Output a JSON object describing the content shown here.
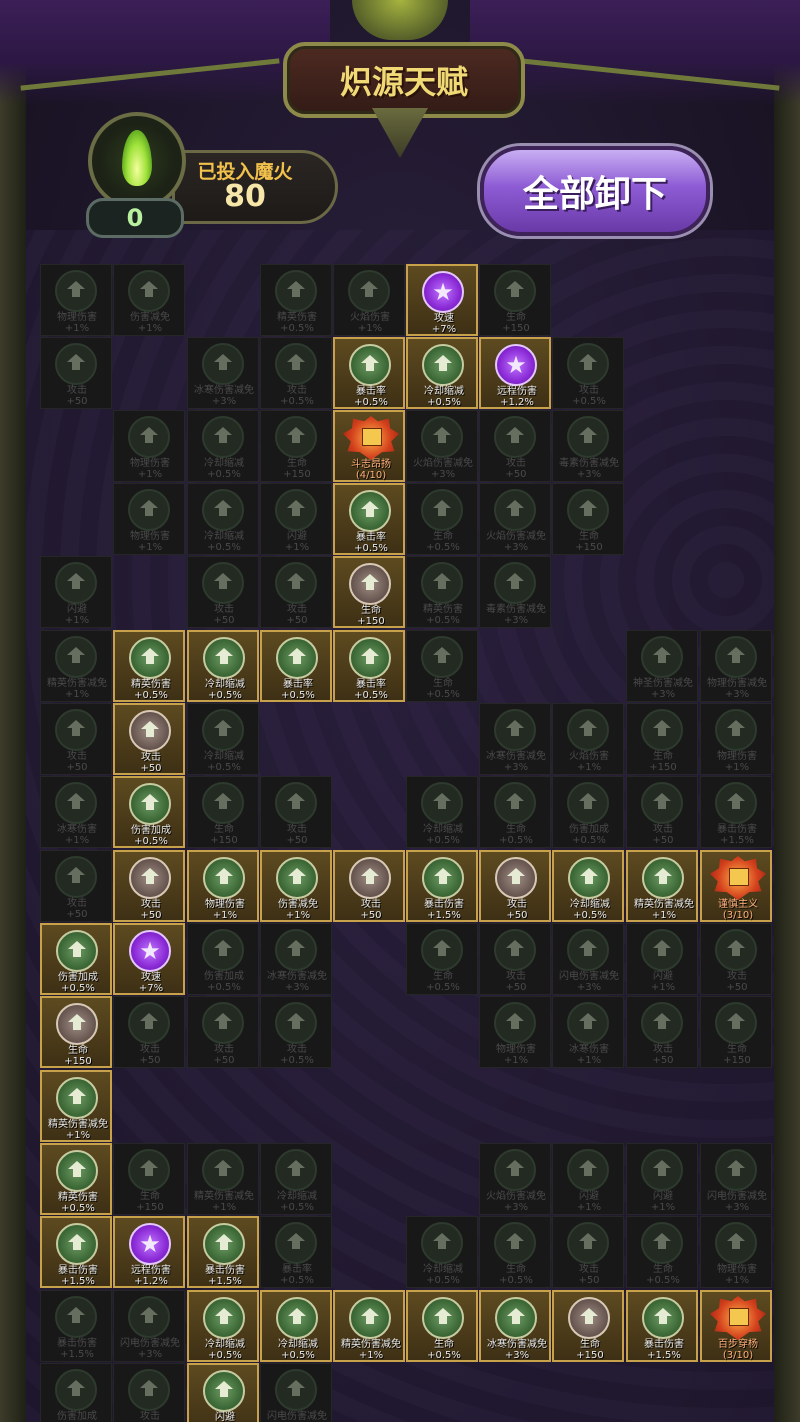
{
  "header": {
    "title": "炽源天赋"
  },
  "fire": {
    "invested_label": "已投入魔火",
    "invested_value": "80",
    "available": "0"
  },
  "actions": {
    "unload_all_label": "全部卸下"
  },
  "colors": {
    "active_border": "#c8a24a",
    "green_node": "#3e6b38",
    "brown_node": "#6c5b54",
    "purple_node": "#8a2ad6",
    "rank_node": "#d4411d",
    "button": "#8d5bd4"
  },
  "talents": [
    {
      "id": "t0",
      "name": "物理伤害",
      "bonus": "+1%",
      "state": "inactive",
      "icon": "arrow-up-icon"
    },
    {
      "id": "t1",
      "name": "伤害减免",
      "bonus": "+1%",
      "state": "inactive",
      "icon": "arrow-up-icon"
    },
    {
      "id": "t2",
      "name": "精英伤害",
      "bonus": "+0.5%",
      "state": "inactive",
      "icon": "arrow-up-icon"
    },
    {
      "id": "t3",
      "name": "火焰伤害",
      "bonus": "+1%",
      "state": "inactive",
      "icon": "arrow-up-icon"
    },
    {
      "id": "t4",
      "name": "攻速",
      "bonus": "+7%",
      "state": "active",
      "color": "purple",
      "icon": "star-icon"
    },
    {
      "id": "t5",
      "name": "生命",
      "bonus": "+150",
      "state": "inactive",
      "icon": "arrow-up-icon"
    },
    {
      "id": "t6",
      "name": "攻击",
      "bonus": "+50",
      "state": "inactive",
      "icon": "arrow-up-icon"
    },
    {
      "id": "t7",
      "name": "冰寒伤害减免",
      "bonus": "+3%",
      "state": "inactive",
      "icon": "arrow-up-icon"
    },
    {
      "id": "t8",
      "name": "攻击",
      "bonus": "+0.5%",
      "state": "inactive",
      "icon": "arrow-up-icon"
    },
    {
      "id": "t9",
      "name": "暴击率",
      "bonus": "+0.5%",
      "state": "active",
      "color": "green",
      "icon": "arrow-up-icon"
    },
    {
      "id": "t10",
      "name": "冷却缩减",
      "bonus": "+0.5%",
      "state": "active",
      "color": "green",
      "icon": "arrow-up-icon"
    },
    {
      "id": "t11",
      "name": "远程伤害",
      "bonus": "+1.2%",
      "state": "active",
      "color": "purple",
      "icon": "star-icon"
    },
    {
      "id": "t12",
      "name": "攻击",
      "bonus": "+0.5%",
      "state": "inactive",
      "icon": "arrow-up-icon"
    },
    {
      "id": "t13",
      "name": "物理伤害",
      "bonus": "+1%",
      "state": "inactive",
      "icon": "arrow-up-icon"
    },
    {
      "id": "t14",
      "name": "冷却缩减",
      "bonus": "+0.5%",
      "state": "inactive",
      "icon": "arrow-up-icon"
    },
    {
      "id": "t15",
      "name": "生命",
      "bonus": "+150",
      "state": "inactive",
      "icon": "arrow-up-icon"
    },
    {
      "id": "t16",
      "name": "斗志昂扬",
      "bonus": "(4/10)",
      "state": "rank",
      "icon": "shield-icon"
    },
    {
      "id": "t17",
      "name": "火焰伤害减免",
      "bonus": "+3%",
      "state": "inactive",
      "icon": "arrow-up-icon"
    },
    {
      "id": "t18",
      "name": "攻击",
      "bonus": "+50",
      "state": "inactive",
      "icon": "arrow-up-icon"
    },
    {
      "id": "t19",
      "name": "毒素伤害减免",
      "bonus": "+3%",
      "state": "inactive",
      "icon": "arrow-up-icon"
    },
    {
      "id": "t20",
      "name": "物理伤害",
      "bonus": "+1%",
      "state": "inactive",
      "icon": "arrow-up-icon"
    },
    {
      "id": "t21",
      "name": "冷却缩减",
      "bonus": "+0.5%",
      "state": "inactive",
      "icon": "arrow-up-icon"
    },
    {
      "id": "t22",
      "name": "闪避",
      "bonus": "+1%",
      "state": "inactive",
      "icon": "arrow-up-icon"
    },
    {
      "id": "t23",
      "name": "暴击率",
      "bonus": "+0.5%",
      "state": "active",
      "color": "green",
      "icon": "arrow-up-icon"
    },
    {
      "id": "t24",
      "name": "生命",
      "bonus": "+0.5%",
      "state": "inactive",
      "icon": "arrow-up-icon"
    },
    {
      "id": "t25",
      "name": "火焰伤害减免",
      "bonus": "+3%",
      "state": "inactive",
      "icon": "arrow-up-icon"
    },
    {
      "id": "t26",
      "name": "生命",
      "bonus": "+150",
      "state": "inactive",
      "icon": "arrow-up-icon"
    },
    {
      "id": "t27",
      "name": "闪避",
      "bonus": "+1%",
      "state": "inactive",
      "icon": "arrow-up-icon"
    },
    {
      "id": "t28",
      "name": "攻击",
      "bonus": "+50",
      "state": "inactive",
      "icon": "arrow-up-icon"
    },
    {
      "id": "t29",
      "name": "攻击",
      "bonus": "+50",
      "state": "inactive",
      "icon": "arrow-up-icon"
    },
    {
      "id": "t30",
      "name": "生命",
      "bonus": "+150",
      "state": "active",
      "color": "brown",
      "icon": "arrow-up-icon"
    },
    {
      "id": "t31",
      "name": "精英伤害",
      "bonus": "+0.5%",
      "state": "inactive",
      "icon": "arrow-up-icon"
    },
    {
      "id": "t32",
      "name": "毒素伤害减免",
      "bonus": "+3%",
      "state": "inactive",
      "icon": "arrow-up-icon"
    },
    {
      "id": "t33",
      "name": "精英伤害减免",
      "bonus": "+1%",
      "state": "inactive",
      "icon": "arrow-up-icon"
    },
    {
      "id": "t34",
      "name": "精英伤害",
      "bonus": "+0.5%",
      "state": "active",
      "color": "green",
      "icon": "arrow-up-icon"
    },
    {
      "id": "t35",
      "name": "冷却缩减",
      "bonus": "+0.5%",
      "state": "active",
      "color": "green",
      "icon": "arrow-up-icon"
    },
    {
      "id": "t36",
      "name": "暴击率",
      "bonus": "+0.5%",
      "state": "active",
      "color": "green",
      "icon": "arrow-up-icon"
    },
    {
      "id": "t37",
      "name": "暴击率",
      "bonus": "+0.5%",
      "state": "active",
      "color": "green",
      "icon": "arrow-up-icon"
    },
    {
      "id": "t38",
      "name": "生命",
      "bonus": "+0.5%",
      "state": "inactive",
      "icon": "arrow-up-icon"
    },
    {
      "id": "t39",
      "name": "神圣伤害减免",
      "bonus": "+3%",
      "state": "inactive",
      "icon": "arrow-up-icon"
    },
    {
      "id": "t40",
      "name": "物理伤害减免",
      "bonus": "+3%",
      "state": "inactive",
      "icon": "arrow-up-icon"
    },
    {
      "id": "t41",
      "name": "攻击",
      "bonus": "+50",
      "state": "inactive",
      "icon": "arrow-up-icon"
    },
    {
      "id": "t42",
      "name": "攻击",
      "bonus": "+50",
      "state": "active",
      "color": "brown",
      "icon": "arrow-up-icon"
    },
    {
      "id": "t43",
      "name": "冷却缩减",
      "bonus": "+0.5%",
      "state": "inactive",
      "icon": "arrow-up-icon"
    },
    {
      "id": "t44",
      "name": "冰寒伤害减免",
      "bonus": "+3%",
      "state": "inactive",
      "icon": "arrow-up-icon"
    },
    {
      "id": "t45",
      "name": "火焰伤害",
      "bonus": "+1%",
      "state": "inactive",
      "icon": "arrow-up-icon"
    },
    {
      "id": "t46",
      "name": "生命",
      "bonus": "+150",
      "state": "inactive",
      "icon": "arrow-up-icon"
    },
    {
      "id": "t47",
      "name": "物理伤害",
      "bonus": "+1%",
      "state": "inactive",
      "icon": "arrow-up-icon"
    },
    {
      "id": "t48",
      "name": "冰寒伤害",
      "bonus": "+1%",
      "state": "inactive",
      "icon": "arrow-up-icon"
    },
    {
      "id": "t49",
      "name": "伤害加成",
      "bonus": "+0.5%",
      "state": "active",
      "color": "green",
      "icon": "arrow-up-icon"
    },
    {
      "id": "t50",
      "name": "生命",
      "bonus": "+150",
      "state": "inactive",
      "icon": "arrow-up-icon"
    },
    {
      "id": "t51",
      "name": "攻击",
      "bonus": "+50",
      "state": "inactive",
      "icon": "arrow-up-icon"
    },
    {
      "id": "t52",
      "name": "冷却缩减",
      "bonus": "+0.5%",
      "state": "inactive",
      "icon": "arrow-up-icon"
    },
    {
      "id": "t53",
      "name": "生命",
      "bonus": "+0.5%",
      "state": "inactive",
      "icon": "arrow-up-icon"
    },
    {
      "id": "t54",
      "name": "伤害加成",
      "bonus": "+0.5%",
      "state": "inactive",
      "icon": "arrow-up-icon"
    },
    {
      "id": "t55",
      "name": "攻击",
      "bonus": "+50",
      "state": "inactive",
      "icon": "arrow-up-icon"
    },
    {
      "id": "t56",
      "name": "暴击伤害",
      "bonus": "+1.5%",
      "state": "inactive",
      "icon": "arrow-up-icon"
    },
    {
      "id": "t57",
      "name": "攻击",
      "bonus": "+50",
      "state": "inactive",
      "icon": "arrow-up-icon"
    },
    {
      "id": "t58",
      "name": "攻击",
      "bonus": "+50",
      "state": "active",
      "color": "brown",
      "icon": "arrow-up-icon"
    },
    {
      "id": "t59",
      "name": "物理伤害",
      "bonus": "+1%",
      "state": "active",
      "color": "green",
      "icon": "arrow-up-icon"
    },
    {
      "id": "t60",
      "name": "伤害减免",
      "bonus": "+1%",
      "state": "active",
      "color": "green",
      "icon": "arrow-up-icon"
    },
    {
      "id": "t61",
      "name": "攻击",
      "bonus": "+50",
      "state": "active",
      "color": "brown",
      "icon": "arrow-up-icon"
    },
    {
      "id": "t62",
      "name": "暴击伤害",
      "bonus": "+1.5%",
      "state": "active",
      "color": "green",
      "icon": "arrow-up-icon"
    },
    {
      "id": "t63",
      "name": "攻击",
      "bonus": "+50",
      "state": "active",
      "color": "brown",
      "icon": "arrow-up-icon"
    },
    {
      "id": "t64",
      "name": "冷却缩减",
      "bonus": "+0.5%",
      "state": "active",
      "color": "green",
      "icon": "arrow-up-icon"
    },
    {
      "id": "t65",
      "name": "精英伤害减免",
      "bonus": "+1%",
      "state": "active",
      "color": "green",
      "icon": "arrow-up-icon"
    },
    {
      "id": "t66",
      "name": "谨慎主义",
      "bonus": "(3/10)",
      "state": "rank",
      "icon": "shield-icon"
    },
    {
      "id": "t67",
      "name": "伤害加成",
      "bonus": "+0.5%",
      "state": "active",
      "color": "green",
      "icon": "arrow-up-icon"
    },
    {
      "id": "t68",
      "name": "攻速",
      "bonus": "+7%",
      "state": "active",
      "color": "purple",
      "icon": "star-icon"
    },
    {
      "id": "t69",
      "name": "伤害加成",
      "bonus": "+0.5%",
      "state": "inactive",
      "icon": "arrow-up-icon"
    },
    {
      "id": "t70",
      "name": "冰寒伤害减免",
      "bonus": "+3%",
      "state": "inactive",
      "icon": "arrow-up-icon"
    },
    {
      "id": "t71",
      "name": "生命",
      "bonus": "+0.5%",
      "state": "inactive",
      "icon": "arrow-up-icon"
    },
    {
      "id": "t72",
      "name": "攻击",
      "bonus": "+50",
      "state": "inactive",
      "icon": "arrow-up-icon"
    },
    {
      "id": "t73",
      "name": "闪电伤害减免",
      "bonus": "+3%",
      "state": "inactive",
      "icon": "arrow-up-icon"
    },
    {
      "id": "t74",
      "name": "闪避",
      "bonus": "+1%",
      "state": "inactive",
      "icon": "arrow-up-icon"
    },
    {
      "id": "t75",
      "name": "攻击",
      "bonus": "+50",
      "state": "inactive",
      "icon": "arrow-up-icon"
    },
    {
      "id": "t76",
      "name": "生命",
      "bonus": "+150",
      "state": "active",
      "color": "brown",
      "icon": "arrow-up-icon"
    },
    {
      "id": "t77",
      "name": "攻击",
      "bonus": "+50",
      "state": "inactive",
      "icon": "arrow-up-icon"
    },
    {
      "id": "t78",
      "name": "攻击",
      "bonus": "+50",
      "state": "inactive",
      "icon": "arrow-up-icon"
    },
    {
      "id": "t79",
      "name": "攻击",
      "bonus": "+0.5%",
      "state": "inactive",
      "icon": "arrow-up-icon"
    },
    {
      "id": "t80",
      "name": "物理伤害",
      "bonus": "+1%",
      "state": "inactive",
      "icon": "arrow-up-icon"
    },
    {
      "id": "t81",
      "name": "冰寒伤害",
      "bonus": "+1%",
      "state": "inactive",
      "icon": "arrow-up-icon"
    },
    {
      "id": "t82",
      "name": "攻击",
      "bonus": "+50",
      "state": "inactive",
      "icon": "arrow-up-icon"
    },
    {
      "id": "t83",
      "name": "生命",
      "bonus": "+150",
      "state": "inactive",
      "icon": "arrow-up-icon"
    },
    {
      "id": "t84",
      "name": "精英伤害减免",
      "bonus": "+1%",
      "state": "active",
      "color": "green",
      "icon": "arrow-up-icon"
    },
    {
      "id": "t85",
      "name": "精英伤害",
      "bonus": "+0.5%",
      "state": "active",
      "color": "green",
      "icon": "arrow-up-icon"
    },
    {
      "id": "t86",
      "name": "生命",
      "bonus": "+150",
      "state": "inactive",
      "icon": "arrow-up-icon"
    },
    {
      "id": "t87",
      "name": "精英伤害减免",
      "bonus": "+1%",
      "state": "inactive",
      "icon": "arrow-up-icon"
    },
    {
      "id": "t88",
      "name": "冷却缩减",
      "bonus": "+0.5%",
      "state": "inactive",
      "icon": "arrow-up-icon"
    },
    {
      "id": "t89",
      "name": "火焰伤害减免",
      "bonus": "+3%",
      "state": "inactive",
      "icon": "arrow-up-icon"
    },
    {
      "id": "t90",
      "name": "闪避",
      "bonus": "+1%",
      "state": "inactive",
      "icon": "arrow-up-icon"
    },
    {
      "id": "t91",
      "name": "闪避",
      "bonus": "+1%",
      "state": "inactive",
      "icon": "arrow-up-icon"
    },
    {
      "id": "t92",
      "name": "闪电伤害减免",
      "bonus": "+3%",
      "state": "inactive",
      "icon": "arrow-up-icon"
    },
    {
      "id": "t93",
      "name": "暴击伤害",
      "bonus": "+1.5%",
      "state": "active",
      "color": "green",
      "icon": "arrow-up-icon"
    },
    {
      "id": "t94",
      "name": "远程伤害",
      "bonus": "+1.2%",
      "state": "active",
      "color": "purple",
      "icon": "star-icon"
    },
    {
      "id": "t95",
      "name": "暴击伤害",
      "bonus": "+1.5%",
      "state": "active",
      "color": "green",
      "icon": "arrow-up-icon"
    },
    {
      "id": "t96",
      "name": "暴击率",
      "bonus": "+0.5%",
      "state": "inactive",
      "icon": "arrow-up-icon"
    },
    {
      "id": "t97",
      "name": "冷却缩减",
      "bonus": "+0.5%",
      "state": "inactive",
      "icon": "arrow-up-icon"
    },
    {
      "id": "t98",
      "name": "生命",
      "bonus": "+0.5%",
      "state": "inactive",
      "icon": "arrow-up-icon"
    },
    {
      "id": "t99",
      "name": "攻击",
      "bonus": "+50",
      "state": "inactive",
      "icon": "arrow-up-icon"
    },
    {
      "id": "t100",
      "name": "生命",
      "bonus": "+0.5%",
      "state": "inactive",
      "icon": "arrow-up-icon"
    },
    {
      "id": "t101",
      "name": "物理伤害",
      "bonus": "+1%",
      "state": "inactive",
      "icon": "arrow-up-icon"
    },
    {
      "id": "t102",
      "name": "暴击伤害",
      "bonus": "+1.5%",
      "state": "inactive",
      "icon": "arrow-up-icon"
    },
    {
      "id": "t103",
      "name": "闪电伤害减免",
      "bonus": "+3%",
      "state": "inactive",
      "icon": "arrow-up-icon"
    },
    {
      "id": "t104",
      "name": "冷却缩减",
      "bonus": "+0.5%",
      "state": "active",
      "color": "green",
      "icon": "arrow-up-icon"
    },
    {
      "id": "t105",
      "name": "冷却缩减",
      "bonus": "+0.5%",
      "state": "active",
      "color": "green",
      "icon": "arrow-up-icon"
    },
    {
      "id": "t106",
      "name": "精英伤害减免",
      "bonus": "+1%",
      "state": "active",
      "color": "green",
      "icon": "arrow-up-icon"
    },
    {
      "id": "t107",
      "name": "生命",
      "bonus": "+0.5%",
      "state": "active",
      "color": "green",
      "icon": "arrow-up-icon"
    },
    {
      "id": "t108",
      "name": "冰寒伤害减免",
      "bonus": "+3%",
      "state": "active",
      "color": "green",
      "icon": "arrow-up-icon"
    },
    {
      "id": "t109",
      "name": "生命",
      "bonus": "+150",
      "state": "active",
      "color": "brown",
      "icon": "arrow-up-icon"
    },
    {
      "id": "t110",
      "name": "暴击伤害",
      "bonus": "+1.5%",
      "state": "active",
      "color": "green",
      "icon": "arrow-up-icon"
    },
    {
      "id": "t111",
      "name": "百步穿杨",
      "bonus": "(3/10)",
      "state": "rank",
      "icon": "shield-icon"
    },
    {
      "id": "t112",
      "name": "伤害加成",
      "bonus": "",
      "state": "inactive",
      "icon": "arrow-up-icon"
    },
    {
      "id": "t113",
      "name": "攻击",
      "bonus": "",
      "state": "inactive",
      "icon": "arrow-up-icon"
    },
    {
      "id": "t114",
      "name": "闪避",
      "bonus": "",
      "state": "active",
      "color": "green",
      "icon": "arrow-up-icon"
    },
    {
      "id": "t115",
      "name": "闪电伤害减免",
      "bonus": "",
      "state": "inactive",
      "icon": "arrow-up-icon"
    }
  ]
}
